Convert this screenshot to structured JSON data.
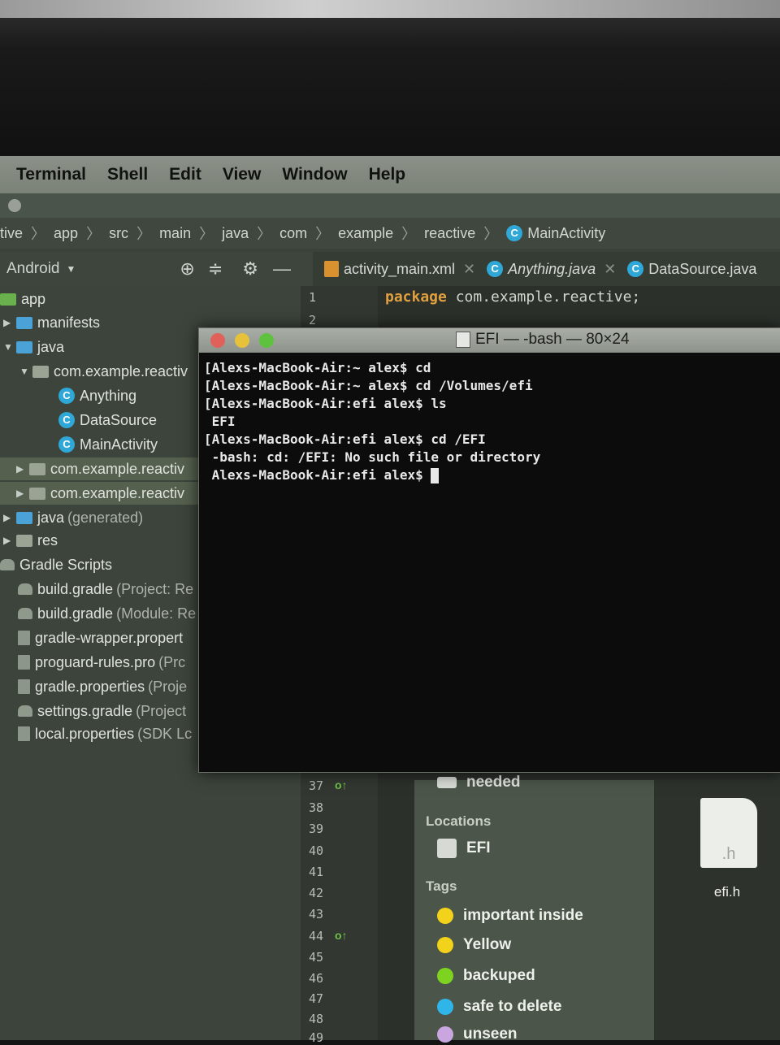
{
  "menubar": {
    "items": [
      "Terminal",
      "Shell",
      "Edit",
      "View",
      "Window",
      "Help"
    ]
  },
  "breadcrumb": [
    "tive",
    "app",
    "src",
    "main",
    "java",
    "com",
    "example",
    "reactive",
    "MainActivity"
  ],
  "project_toolbar": {
    "view_selector": "Android"
  },
  "editor_tabs": [
    {
      "label": "activity_main.xml"
    },
    {
      "label": "Anything.java"
    },
    {
      "label": "DataSource.java"
    }
  ],
  "project_tree": [
    {
      "label": "app",
      "hint": ""
    },
    {
      "label": "manifests",
      "hint": ""
    },
    {
      "label": "java",
      "hint": ""
    },
    {
      "label": "com.example.reactiv",
      "hint": ""
    },
    {
      "label": "Anything",
      "hint": ""
    },
    {
      "label": "DataSource",
      "hint": ""
    },
    {
      "label": "MainActivity",
      "hint": ""
    },
    {
      "label": "com.example.reactiv",
      "hint": ""
    },
    {
      "label": "com.example.reactiv",
      "hint": ""
    },
    {
      "label": "java",
      "hint": "(generated)"
    },
    {
      "label": "res",
      "hint": ""
    },
    {
      "label": "Gradle Scripts",
      "hint": ""
    },
    {
      "label": "build.gradle",
      "hint": "(Project: Re"
    },
    {
      "label": "build.gradle",
      "hint": "(Module: Re"
    },
    {
      "label": "gradle-wrapper.propert",
      "hint": ""
    },
    {
      "label": "proguard-rules.pro",
      "hint": "(Prc"
    },
    {
      "label": "gradle.properties",
      "hint": "(Proje"
    },
    {
      "label": "settings.gradle",
      "hint": "(Project"
    },
    {
      "label": "local.properties",
      "hint": "(SDK Lc"
    }
  ],
  "editor": {
    "line1_keyword": "package",
    "line1_rest": " com.example.reactive;",
    "line_numbers": [
      "1",
      "2",
      "37",
      "38",
      "39",
      "40",
      "41",
      "42",
      "43",
      "44",
      "45",
      "46",
      "47",
      "48",
      "49"
    ]
  },
  "terminal": {
    "title": "EFI — -bash — 80×24",
    "lines": [
      "[Alexs-MacBook-Air:~ alex$ cd",
      "[Alexs-MacBook-Air:~ alex$ cd /Volumes/efi",
      "[Alexs-MacBook-Air:efi alex$ ls",
      " EFI",
      "[Alexs-MacBook-Air:efi alex$ cd /EFI",
      " -bash: cd: /EFI: No such file or directory",
      " Alexs-MacBook-Air:efi alex$ "
    ]
  },
  "finder": {
    "partial_item": "needed",
    "locations_header": "Locations",
    "locations": [
      "EFI"
    ],
    "tags_header": "Tags",
    "tags": [
      {
        "label": "important inside",
        "color": "#f2d21b"
      },
      {
        "label": "Yellow",
        "color": "#f2d21b"
      },
      {
        "label": "backuped",
        "color": "#7ed321"
      },
      {
        "label": "safe to delete",
        "color": "#2fb5e8"
      },
      {
        "label": "unseen",
        "color": "#c9a6e0"
      }
    ],
    "file": {
      "ext": ".h",
      "name": "efi.h"
    }
  }
}
